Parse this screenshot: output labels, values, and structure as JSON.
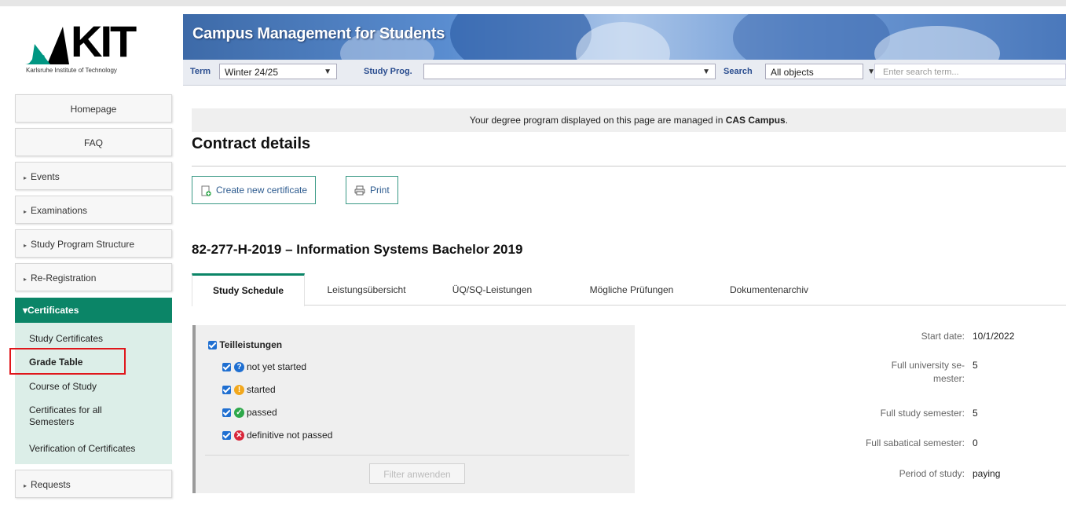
{
  "logo": {
    "name": "KIT",
    "subtitle": "Karlsruhe Institute of Technology"
  },
  "banner": {
    "title": "Campus Management for Students"
  },
  "filterbar": {
    "term_label": "Term",
    "term_value": "Winter 24/25",
    "studyprog_label": "Study Prog.",
    "studyprog_value": "",
    "search_label": "Search",
    "search_scope": "All objects",
    "search_placeholder": "Enter search term..."
  },
  "sidebar": {
    "items": [
      {
        "label": "Homepage"
      },
      {
        "label": "FAQ"
      },
      {
        "label": "Events"
      },
      {
        "label": "Examinations"
      },
      {
        "label": "Study Program Structure"
      },
      {
        "label": "Re-Registration"
      }
    ],
    "active": {
      "label": "Certificates"
    },
    "subitems": [
      {
        "label": "Study Certificates"
      },
      {
        "label": "Grade Table"
      },
      {
        "label": "Course of Study"
      },
      {
        "label": "Certificates for all Semesters"
      },
      {
        "label": "Verification of Certificates"
      }
    ],
    "after": {
      "label": "Requests"
    }
  },
  "notice": {
    "prefix": "Your degree program displayed on this page are managed in ",
    "highlight": "CAS Campus",
    "suffix": "."
  },
  "page_title": "Contract details",
  "buttons": {
    "create_certificate": "Create new certificate",
    "print": "Print"
  },
  "program_title": "82-277-H-2019 – Information Systems Bachelor 2019",
  "tabs": [
    {
      "label": "Study Schedule"
    },
    {
      "label": "Leistungsübersicht"
    },
    {
      "label": "ÜQ/SQ-Leistungen"
    },
    {
      "label": "Mögliche Prüfungen"
    },
    {
      "label": "Dokumentenarchiv"
    }
  ],
  "filter": {
    "group_label": "Teilleistungen",
    "options": [
      {
        "label": "not yet started",
        "icon": "question-icon",
        "color": "#1f6fd1"
      },
      {
        "label": "started",
        "icon": "exclamation-icon",
        "color": "#f2a81d"
      },
      {
        "label": "passed",
        "icon": "check-icon",
        "color": "#2ea84a"
      },
      {
        "label": "definitive not passed",
        "icon": "x-icon",
        "color": "#d9263a"
      }
    ],
    "apply_label": "Filter anwenden"
  },
  "info": {
    "start_date_label": "Start date:",
    "start_date_value": "10/1/2022",
    "full_uni_sem_label": "Full university se- mester:",
    "full_uni_sem_value": "5",
    "full_study_sem_label": "Full study semester:",
    "full_study_sem_value": "5",
    "full_sab_sem_label": "Full sabatical semester:",
    "full_sab_sem_value": "0",
    "period_label": "Period of study:",
    "period_value": "paying"
  },
  "colors": {
    "accent": "#0b8567",
    "highlight_box": "#e0161b"
  }
}
